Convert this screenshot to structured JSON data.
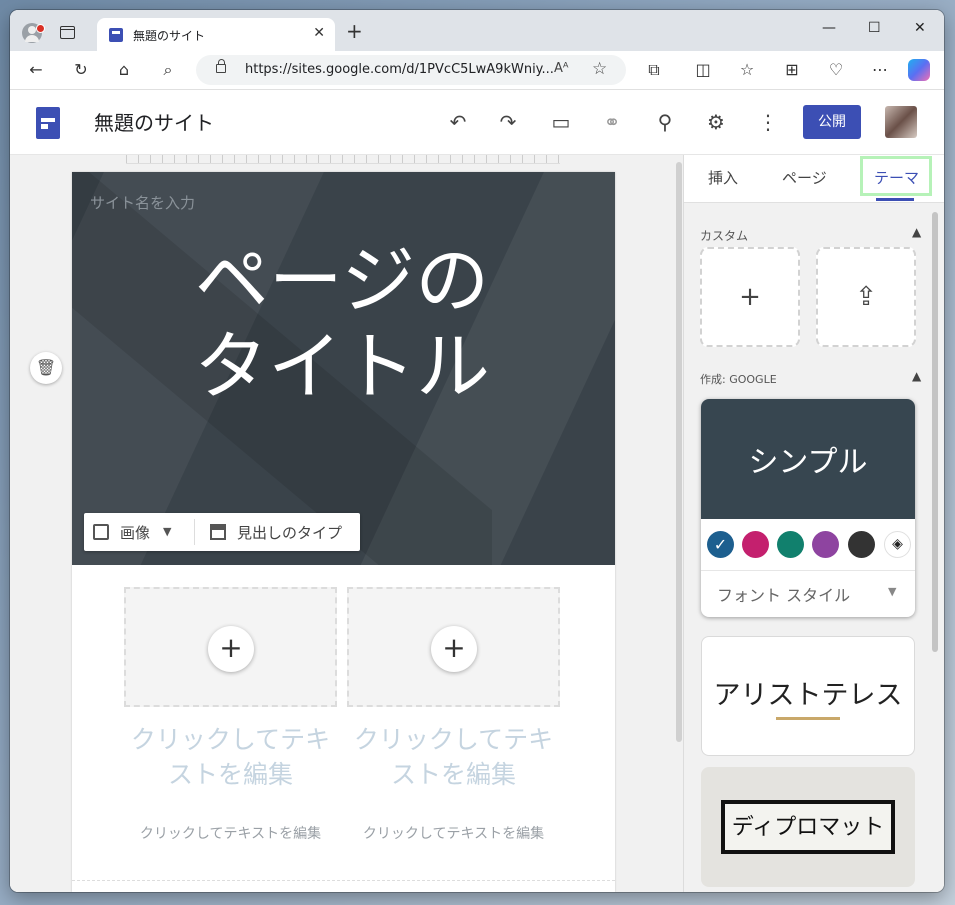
{
  "browser": {
    "tab_title": "無題のサイト",
    "url": "https://sites.google.com/d/1PVcC5LwA9kWniy...",
    "read_aloud": "Aᴬ"
  },
  "sites": {
    "site_title": "無題のサイト",
    "publish_label": "公開",
    "header_icons": [
      "undo-icon",
      "redo-icon",
      "preview-devices-icon",
      "link-icon",
      "add-person-icon",
      "settings-icon",
      "more-vert-icon"
    ]
  },
  "canvas": {
    "site_name_placeholder": "サイト名を入力",
    "page_title": "ページのタイトル",
    "image_label": "画像",
    "header_type_label": "見出しのタイプ",
    "columns": [
      {
        "big": "クリックしてテキストを編集",
        "small": "クリックしてテキストを編集"
      },
      {
        "big": "クリックしてテキストを編集",
        "small": "クリックしてテキストを編集"
      }
    ]
  },
  "panel": {
    "tabs": [
      "挿入",
      "ページ",
      "テーマ"
    ],
    "active_tab": "テーマ",
    "custom_label": "カスタム",
    "google_label": "作成: GOOGLE",
    "themes": {
      "simple": {
        "name": "シンプル",
        "colors": [
          "#1d5f8f",
          "#c4206e",
          "#11806d",
          "#8e44a0",
          "#333333"
        ],
        "font_style_label": "フォント スタイル"
      },
      "aristotle": {
        "name": "アリストテレス",
        "accent": "#c9a86a"
      },
      "diplomat": {
        "name": "ディプロマット"
      }
    }
  },
  "colors": {
    "brand": "#3c4fb4",
    "hero_bg": "#3a434a",
    "active_tab_highlight": "#b6f2b8"
  }
}
